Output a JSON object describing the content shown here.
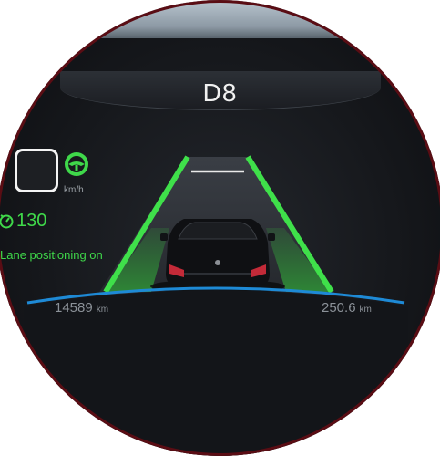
{
  "header": {
    "gear": "D8"
  },
  "speed": {
    "unit": "km/h"
  },
  "limiter": {
    "value": "130"
  },
  "assist": {
    "message": "Lane positioning on"
  },
  "footer": {
    "odometer_value": "14589",
    "odometer_unit": "km",
    "trip_value": "250.6",
    "trip_unit": "km"
  },
  "colors": {
    "assist_green": "#3fd84a",
    "arc_blue": "#1e8ad6",
    "rim": "#5a0d14"
  },
  "icons": [
    "steering-wheel-icon",
    "speed-limiter-icon"
  ]
}
